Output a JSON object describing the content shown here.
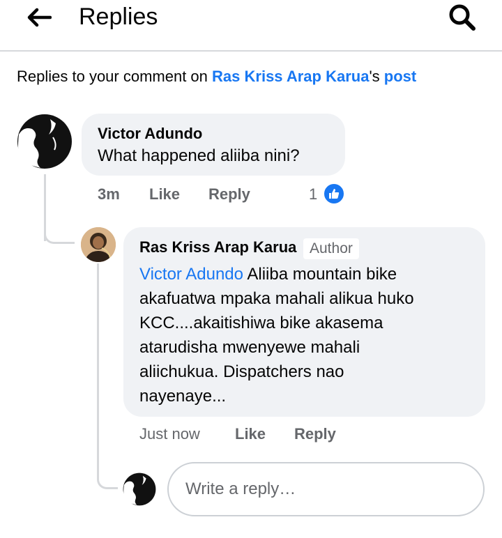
{
  "header": {
    "title": "Replies"
  },
  "context": {
    "prefix": "Replies to your comment on ",
    "post_author": "Ras Kriss Arap Karua",
    "possessive": "'s ",
    "post_link": "post"
  },
  "comment": {
    "author": "Victor Adundo",
    "text": "What happened aliiba nini?",
    "time": "3m",
    "like_label": "Like",
    "reply_label": "Reply",
    "reaction_count": "1",
    "reaction_icon": "thumbs-up-icon"
  },
  "reply": {
    "author": "Ras Kriss Arap Karua",
    "badge": "Author",
    "mention": "Victor Adundo",
    "text_line1": " Aliiba mountain bike",
    "text_line2": "akafuatwa mpaka mahali alikua huko",
    "text_line3": "KCC....akaitishiwa bike akasema",
    "text_line4": "atarudisha mwenyewe mahali",
    "text_line5": "aliichukua. Dispatchers nao",
    "text_line6": "nayenaye...",
    "time": "Just now",
    "like_label": "Like",
    "reply_label": "Reply"
  },
  "composer": {
    "placeholder": "Write a reply…"
  },
  "colors": {
    "accent": "#1877f2",
    "bubble": "#f0f2f5",
    "secondary_text": "#65676b"
  }
}
